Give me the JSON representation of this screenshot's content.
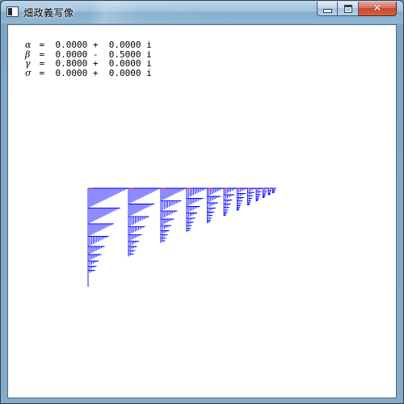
{
  "window": {
    "title": "畑政義写像",
    "buttons": {
      "minimize_icon": "minimize-icon",
      "maximize_icon": "maximize-icon",
      "close_icon": "close-icon",
      "close_glyph": "✕"
    }
  },
  "parameters": [
    {
      "symbol": "α",
      "text": " =  0.0000 +  0.0000 i"
    },
    {
      "symbol": "β",
      "text": " =  0.0000 -  0.5000 i"
    },
    {
      "symbol": "γ",
      "text": " =  0.8000 +  0.0000 i"
    },
    {
      "symbol": "σ",
      "text": " =  0.0000 +  0.0000 i"
    }
  ],
  "fractal": {
    "color": "#0000ff",
    "accent_color": "#ff0000"
  }
}
